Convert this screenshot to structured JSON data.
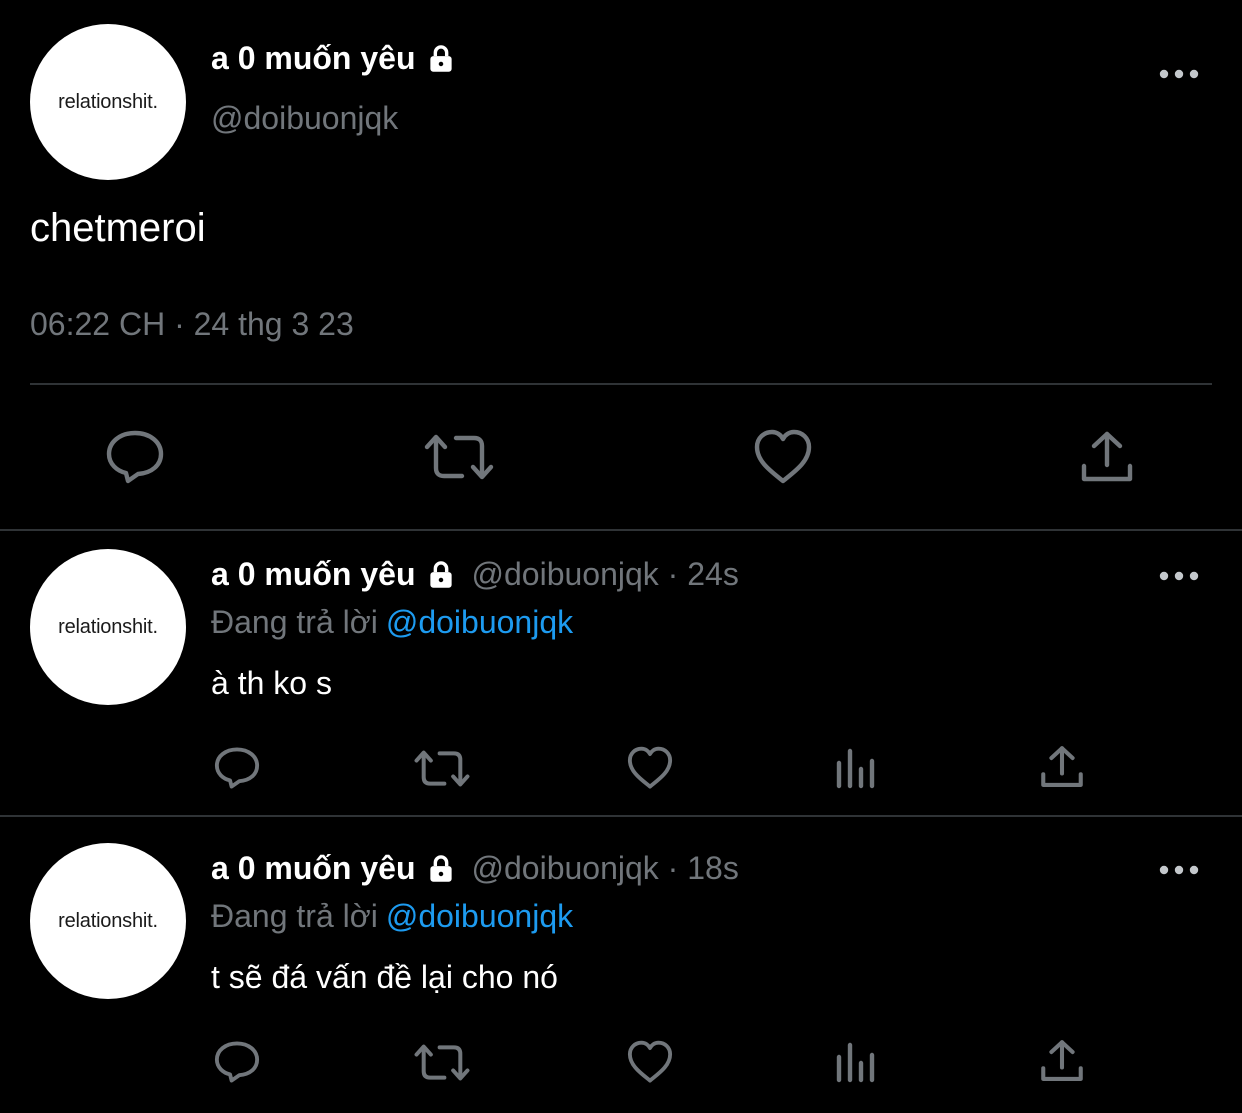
{
  "main_tweet": {
    "avatar_text": "relationshit.",
    "display_name": "a 0 muốn yêu",
    "handle": "@doibuonjqk",
    "text": "chetmeroi",
    "timestamp": "06:22 CH · 24 thg 3 23"
  },
  "replies": [
    {
      "avatar_text": "relationshit.",
      "display_name": "a 0 muốn yêu",
      "meta": "@doibuonjqk · 24s",
      "replying_label": "Đang trả lời",
      "replying_to": "@doibuonjqk",
      "text": "à th ko s"
    },
    {
      "avatar_text": "relationshit.",
      "display_name": "a 0 muốn yêu",
      "meta": "@doibuonjqk · 18s",
      "replying_label": "Đang trả lời",
      "replying_to": "@doibuonjqk",
      "text": "t sẽ đá vấn đề lại cho nó"
    }
  ],
  "icons": [
    "lock-icon",
    "more-icon",
    "reply-icon",
    "retweet-icon",
    "like-icon",
    "views-icon",
    "share-icon"
  ],
  "colors": {
    "background": "#000000",
    "text": "#ffffff",
    "secondary": "#71767b",
    "link": "#1d9bf0",
    "divider": "#2f3336"
  }
}
